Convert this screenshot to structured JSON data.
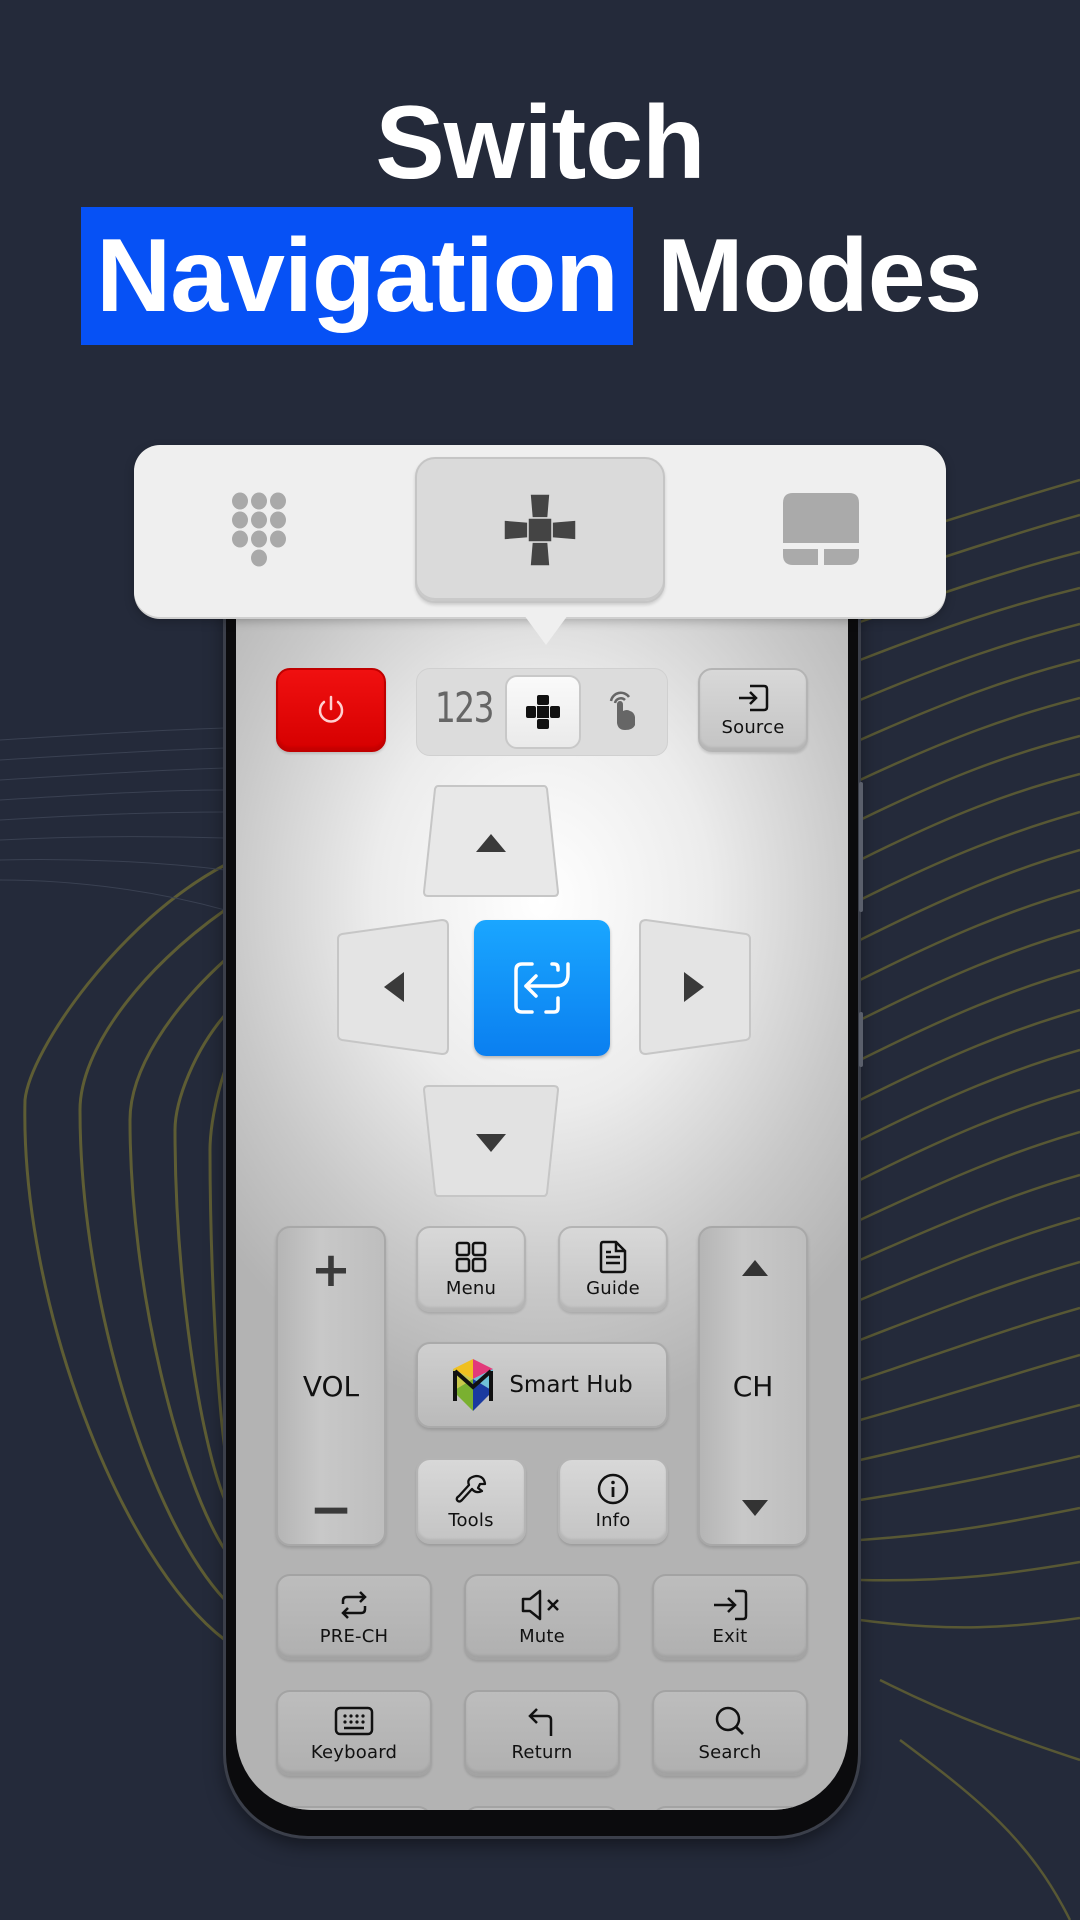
{
  "headline": {
    "line1": "Switch",
    "highlight": "Navigation",
    "rest": "Modes"
  },
  "colors": {
    "background": "#242a3a",
    "highlight": "#0651f5",
    "power": "#e60000",
    "ok": "#0a8af5",
    "lines": "#6b6a35"
  },
  "mode_popup": {
    "options": [
      {
        "name": "numpad",
        "icon": "numpad-icon",
        "active": false
      },
      {
        "name": "dpad",
        "icon": "dpad-icon",
        "active": true
      },
      {
        "name": "touchpad",
        "icon": "touchpad-icon",
        "active": false
      }
    ]
  },
  "remote": {
    "top_row": {
      "power_icon": "power-icon",
      "mode_switch": {
        "numpad_label": "123",
        "active": "dpad"
      },
      "source_label": "Source"
    },
    "dpad": {
      "up": "up-arrow",
      "down": "down-arrow",
      "left": "left-arrow",
      "right": "right-arrow",
      "ok_icon": "enter-icon"
    },
    "vol": {
      "plus": "+",
      "label": "VOL",
      "minus": "−"
    },
    "ch": {
      "label": "CH"
    },
    "menu_label": "Menu",
    "guide_label": "Guide",
    "smart_hub_label": "Smart Hub",
    "tools_label": "Tools",
    "info_label": "Info",
    "pre_ch_label": "PRE-CH",
    "mute_label": "Mute",
    "exit_label": "Exit",
    "keyboard_label": "Keyboard",
    "return_label": "Return",
    "search_label": "Search"
  }
}
